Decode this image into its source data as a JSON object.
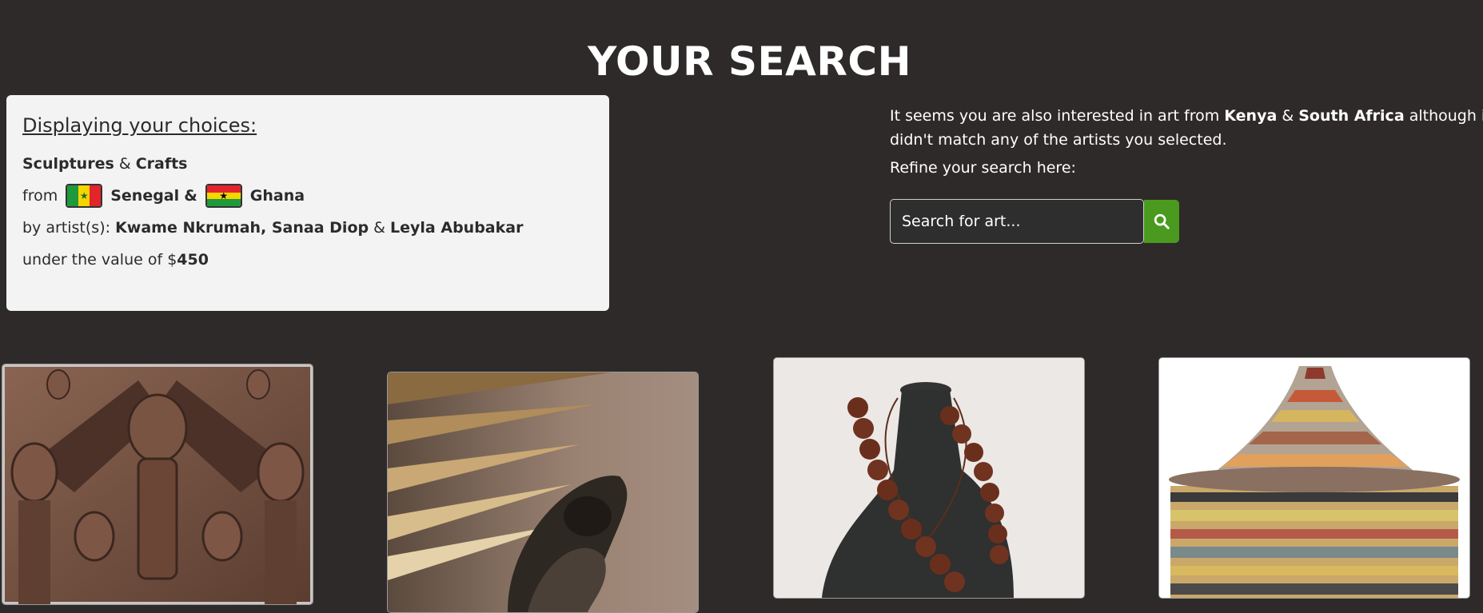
{
  "page": {
    "title": "YOUR SEARCH"
  },
  "choices": {
    "heading": "Displaying your choices:",
    "categories": [
      "Sculptures",
      "Crafts"
    ],
    "amp": "&",
    "from_label": "from",
    "countries": [
      {
        "name": "Senegal",
        "flag": "senegal-flag-icon",
        "colors": [
          "#1e9a3c",
          "#f6d500",
          "#e3242b"
        ]
      },
      {
        "name": "Ghana",
        "flag": "ghana-flag-icon",
        "colors": [
          "#e3242b",
          "#f6d500",
          "#1e9a3c"
        ]
      }
    ],
    "country_amp": "&",
    "artists_label": "by artist(s):",
    "artists": [
      "Kwame Nkrumah, Sanaa Diop",
      "Leyla Abubakar"
    ],
    "value_label": "under the value of $",
    "value": "450"
  },
  "suggestion": {
    "text_1": "It seems you are also interested in art from",
    "country_1": "Kenya",
    "amp": "&",
    "country_2": "South Africa",
    "text_2": "although it didn't match any of the artists you selected.",
    "refine_label": "Refine your search here:"
  },
  "search": {
    "placeholder": "Search for art...",
    "button_icon": "search-icon"
  },
  "colors": {
    "background": "#2e2a29",
    "panel": "#f3f3f3",
    "accent": "#4a9a1f"
  },
  "artworks": [
    {
      "icon": "bronze-plaque-image"
    },
    {
      "icon": "stone-sculpture-image"
    },
    {
      "icon": "bead-necklace-image"
    },
    {
      "icon": "woven-basket-image"
    }
  ]
}
